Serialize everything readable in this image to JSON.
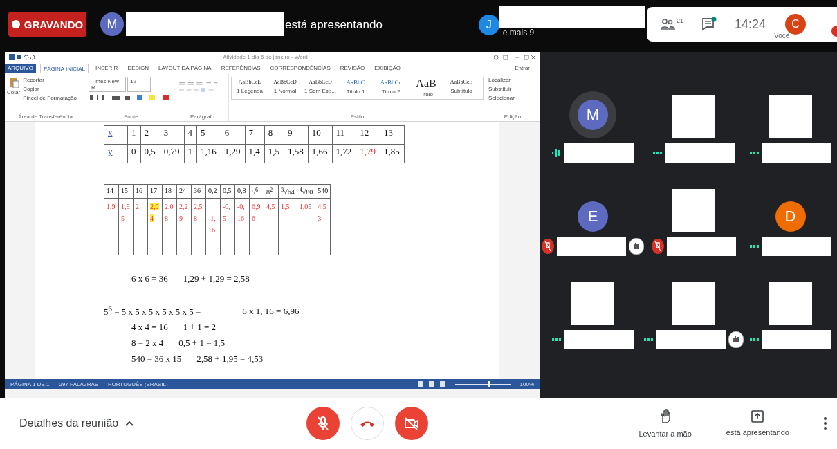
{
  "top_bar": {
    "recording_label": "GRAVANDO",
    "presenter": {
      "initial": "M",
      "color": "#5c6bc0",
      "text": "está apresentando"
    },
    "others": {
      "initial": "J",
      "color": "#1e88e5",
      "text": "e mais 9"
    },
    "participants_count": "21",
    "chat_unread": true,
    "time": "14:24",
    "self": {
      "initial": "C",
      "color": "#d84315",
      "label": "Você"
    }
  },
  "word": {
    "title": "Atividade 1 dia 5 de janeiro - Word",
    "sign_in": "Entrar",
    "tabs": [
      {
        "label": "ARQUIVO",
        "kind": "file",
        "selected": false
      },
      {
        "label": "PÁGINA INICIAL",
        "kind": "tab",
        "selected": true
      },
      {
        "label": "INSERIR",
        "kind": "tab",
        "selected": false
      },
      {
        "label": "DESIGN",
        "kind": "tab",
        "selected": false
      },
      {
        "label": "LAYOUT DA PÁGINA",
        "kind": "tab",
        "selected": false
      },
      {
        "label": "REFERÊNCIAS",
        "kind": "tab",
        "selected": false
      },
      {
        "label": "CORRESPONDÊNCIAS",
        "kind": "tab",
        "selected": false
      },
      {
        "label": "REVISÃO",
        "kind": "tab",
        "selected": false
      },
      {
        "label": "EXIBIÇÃO",
        "kind": "tab",
        "selected": false
      }
    ],
    "ribbon": {
      "clipboard": {
        "label": "Área de Transferência",
        "paste": "Colar",
        "items": [
          "Recortar",
          "Copiar",
          "Pincel de Formatação"
        ]
      },
      "font": {
        "label": "Fonte",
        "family": "Times New R",
        "size": "12"
      },
      "paragraph": {
        "label": "Parágrafo"
      },
      "styles": {
        "label": "Estilo",
        "items": [
          {
            "sample": "AaBbCcE",
            "name": "1 Legenda",
            "kind": "normal"
          },
          {
            "sample": "AaBbCcD",
            "name": "1 Normal",
            "kind": "normal"
          },
          {
            "sample": "AaBbCcD",
            "name": "1 Sem Esp...",
            "kind": "normal"
          },
          {
            "sample": "AaBbC",
            "name": "Título 1",
            "kind": "heading"
          },
          {
            "sample": "AaBbCc",
            "name": "Título 2",
            "kind": "heading"
          },
          {
            "sample": "AaB",
            "name": "Título",
            "kind": "title"
          },
          {
            "sample": "AaBbCcE",
            "name": "Subtítulo",
            "kind": "normal"
          }
        ]
      },
      "editing": {
        "label": "Edição",
        "items": [
          "Localizar",
          "Substituir",
          "Selecionar"
        ]
      }
    },
    "table_1": {
      "rows": [
        {
          "label": "x",
          "cells": [
            {
              "text": "1",
              "marked": false
            },
            {
              "text": "2",
              "marked": false
            },
            {
              "text": "3",
              "marked": false
            },
            {
              "text": "4",
              "marked": false
            },
            {
              "text": "5",
              "marked": false
            },
            {
              "text": "6",
              "marked": false
            },
            {
              "text": "7",
              "marked": false
            },
            {
              "text": "8",
              "marked": false
            },
            {
              "text": "9",
              "marked": false
            },
            {
              "text": "10",
              "marked": false
            },
            {
              "text": "11",
              "marked": false
            },
            {
              "text": "12",
              "marked": false
            },
            {
              "text": "13",
              "marked": false
            }
          ]
        },
        {
          "label": "y",
          "cells": [
            {
              "text": "0",
              "marked": false
            },
            {
              "text": "0,5",
              "marked": false
            },
            {
              "text": "0,79",
              "marked": false
            },
            {
              "text": "1",
              "marked": false
            },
            {
              "text": "1,16",
              "marked": false
            },
            {
              "text": "1,29",
              "marked": false
            },
            {
              "text": "1,4",
              "marked": false
            },
            {
              "text": "1,5",
              "marked": false
            },
            {
              "text": "1,58",
              "marked": false
            },
            {
              "text": "1,66",
              "marked": false
            },
            {
              "text": "1,72",
              "marked": false
            },
            {
              "text": "1,79",
              "marked": true
            },
            {
              "text": "1,85",
              "marked": false
            }
          ]
        }
      ]
    },
    "table_2": {
      "header": [
        "14",
        "15",
        "16",
        "17",
        "18",
        "24",
        "36",
        "0,2",
        "0,5",
        "0,8",
        "5$^{6}$",
        "8$^{2}$",
        "$^{3}$√64",
        "$^{4}$√80",
        "540"
      ],
      "values": [
        {
          "text": "1,9",
          "highlight": false,
          "kind": "top"
        },
        {
          "text": "1,95",
          "highlight": false,
          "kind": "top"
        },
        {
          "text": "2",
          "highlight": false,
          "kind": "top"
        },
        {
          "text": "2,04",
          "highlight": true,
          "kind": "top"
        },
        {
          "text": "2,08",
          "highlight": false,
          "kind": "top"
        },
        {
          "text": "2,29",
          "highlight": false,
          "kind": "top"
        },
        {
          "text": "2,58",
          "highlight": false,
          "kind": "top"
        },
        {
          "text": "-1,16",
          "highlight": false,
          "kind": "lower"
        },
        {
          "text": "-0,5",
          "highlight": false,
          "kind": "top"
        },
        {
          "text": "-0,16",
          "highlight": false,
          "kind": "top"
        },
        {
          "text": "6,96",
          "highlight": false,
          "kind": "top"
        },
        {
          "text": "4,5",
          "highlight": false,
          "kind": "top"
        },
        {
          "text": "1,5",
          "highlight": false,
          "kind": "top"
        },
        {
          "text": "1,05",
          "highlight": false,
          "kind": "top"
        },
        {
          "text": "4,53",
          "highlight": false,
          "kind": "top"
        }
      ]
    },
    "equations": [
      {
        "kind": "indented",
        "parts": [
          "6 x 6 = 36",
          "1,29 + 1,29 = 2,58"
        ]
      },
      {
        "kind": "flush",
        "parts": [
          "5$^{6}$ = 5 x 5 x 5 x 5 x 5 x 5 =",
          "6 x 1, 16 = 6,96"
        ]
      },
      {
        "kind": "indented",
        "parts": [
          "4 x 4 = 16",
          "1 + 1 = 2"
        ]
      },
      {
        "kind": "indented",
        "parts": [
          "8 = 2 x 4",
          "0,5 + 1 = 1,5"
        ]
      },
      {
        "kind": "indented",
        "parts": [
          "540 = 36 x 15",
          "2,58 + 1,95 = 4,53"
        ]
      }
    ],
    "status_bar": {
      "page": "PÁGINA 1 DE 1",
      "words": "297 PALAVRAS",
      "language": "PORTUGUÊS (BRASIL)",
      "zoom": {
        "level": 0.6,
        "reading": "100%"
      }
    }
  },
  "participants": [
    {
      "kind": "avatar",
      "initial": "M",
      "color": "#5c6bc0",
      "muted": false,
      "speaking": true,
      "hand_raised": false
    },
    {
      "kind": "hidden",
      "muted": false,
      "speaking": false,
      "hand_raised": false
    },
    {
      "kind": "hidden",
      "muted": false,
      "speaking": false,
      "hand_raised": false
    },
    {
      "kind": "avatar",
      "initial": "E",
      "color": "#5c6bc0",
      "muted": true,
      "speaking": false,
      "hand_raised": true
    },
    {
      "kind": "hidden",
      "muted": true,
      "speaking": false,
      "hand_raised": false
    },
    {
      "kind": "avatar",
      "initial": "D",
      "color": "#ef6c00",
      "muted": false,
      "speaking": false,
      "hand_raised": false
    },
    {
      "kind": "hidden",
      "muted": false,
      "speaking": false,
      "hand_raised": false
    },
    {
      "kind": "hidden",
      "muted": false,
      "speaking": false,
      "hand_raised": true
    },
    {
      "kind": "hidden",
      "muted": false,
      "speaking": false,
      "hand_raised": false
    }
  ],
  "bottom_bar": {
    "details": "Detalhes da reunião",
    "mic_on": false,
    "camera_on": false,
    "raise_hand": "Levantar a mão",
    "presenting": "está apresentando"
  }
}
